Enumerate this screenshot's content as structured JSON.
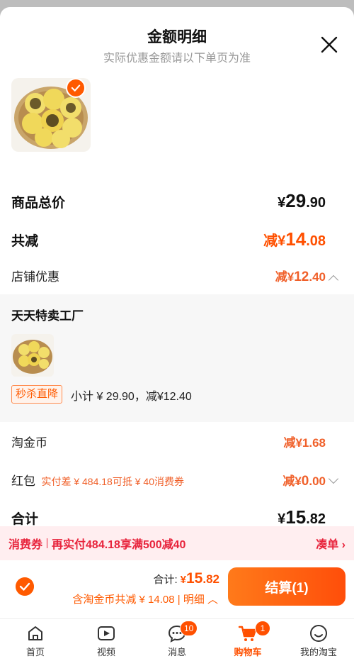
{
  "header": {
    "title": "金额明细",
    "subtitle": "实际优惠金额请以下单页为准"
  },
  "summary": {
    "goods_total_label": "商品总价",
    "goods_total": {
      "cur": "¥",
      "int": "29",
      "dec": ".90"
    },
    "discount_label": "共减",
    "discount": {
      "prefix": "减",
      "cur": "¥",
      "int": "14",
      "dec": ".08"
    },
    "shop_discount_label": "店铺优惠",
    "shop_discount": {
      "prefix": "减",
      "cur": "¥",
      "int": "12",
      "dec": ".40"
    }
  },
  "shop": {
    "name": "天天特卖工厂",
    "tag": "秒杀直降",
    "subtotal_text": "小计 ¥ 29.90，减¥12.40"
  },
  "taojinbi": {
    "label": "淘金币",
    "value": "减¥1.68"
  },
  "hongbao": {
    "label": "红包",
    "note": "实付差 ¥ 484.18可抵 ¥ 40消费券",
    "value": {
      "prefix": "减",
      "cur": "¥",
      "int": "0",
      "dec": ".00"
    }
  },
  "total": {
    "label": "合计",
    "cur": "¥",
    "int": "15",
    "dec": ".82"
  },
  "coupon_bar": {
    "left": "消费券",
    "middle": "再实付484.18享满500减40",
    "right": "凑单"
  },
  "footer": {
    "total_label": "合计:",
    "total": {
      "cur": "¥",
      "int": "15",
      "dec": ".82"
    },
    "detail_text": "含淘金币共减 ¥ 14.08 | 明细",
    "checkout_label": "结算(1)"
  },
  "tabbar": [
    {
      "label": "首页",
      "icon": "home-icon"
    },
    {
      "label": "视频",
      "icon": "video-icon"
    },
    {
      "label": "消息",
      "icon": "message-icon",
      "badge": "10"
    },
    {
      "label": "购物车",
      "icon": "cart-icon",
      "badge": "1",
      "active": true
    },
    {
      "label": "我的淘宝",
      "icon": "profile-icon"
    }
  ],
  "colors": {
    "accent": "#ff5000",
    "coupon_red": "#e8243c",
    "coupon_bg": "#ffeef0"
  }
}
